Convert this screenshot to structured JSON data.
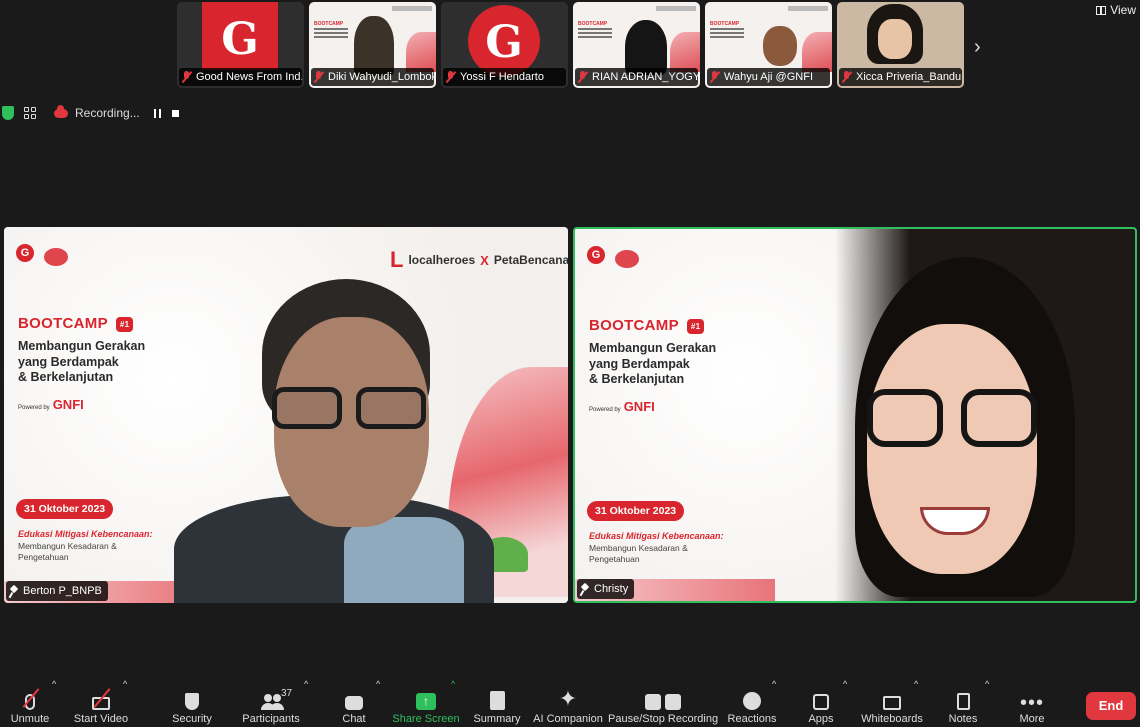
{
  "gallery": {
    "thumbnails": [
      {
        "name": "Good News From Ind..."
      },
      {
        "name": "Diki Wahyudi_Lombok"
      },
      {
        "name": "Yossi F Hendarto"
      },
      {
        "name": "RIAN ADRIAN_YOGY..."
      },
      {
        "name": "Wahyu Aji @GNFI"
      },
      {
        "name": "Xicca Priveria_Bandu..."
      }
    ],
    "slide_mini_title": "BOOTCAMP"
  },
  "view_label": "View",
  "recording": {
    "label": "Recording..."
  },
  "slide": {
    "brand_right": "localheroes",
    "partner": "PetaBencana.id",
    "x": "X",
    "partner_short": "P",
    "bootcamp": "BOOTCAMP",
    "bootcamp_num": "#1",
    "headline_1": "Membangun Gerakan",
    "headline_2": "yang Berdampak",
    "headline_3": "& Berkelanjutan",
    "powered_by": "Powered by",
    "powered_brand": "GNFI",
    "date": "31 Oktober 2023",
    "edu_title": "Edukasi Mitigasi Kebencanaan:",
    "edu_sub": "Membangun Kesadaran & Pengetahuan"
  },
  "tiles": {
    "left_name": "Berton P_BNPB",
    "right_name": "Christy"
  },
  "toolbar": {
    "unmute": "Unmute",
    "start_video": "Start Video",
    "security": "Security",
    "participants": "Participants",
    "participants_count": "37",
    "chat": "Chat",
    "share_screen": "Share Screen",
    "summary": "Summary",
    "ai_companion": "AI Companion",
    "pause_stop": "Pause/Stop Recording",
    "reactions": "Reactions",
    "apps": "Apps",
    "whiteboards": "Whiteboards",
    "notes": "Notes",
    "more": "More",
    "end": "End"
  },
  "colors": {
    "accent_green": "#2fbf5d",
    "end_red": "#e0383e",
    "brand_red": "#d9262e"
  }
}
